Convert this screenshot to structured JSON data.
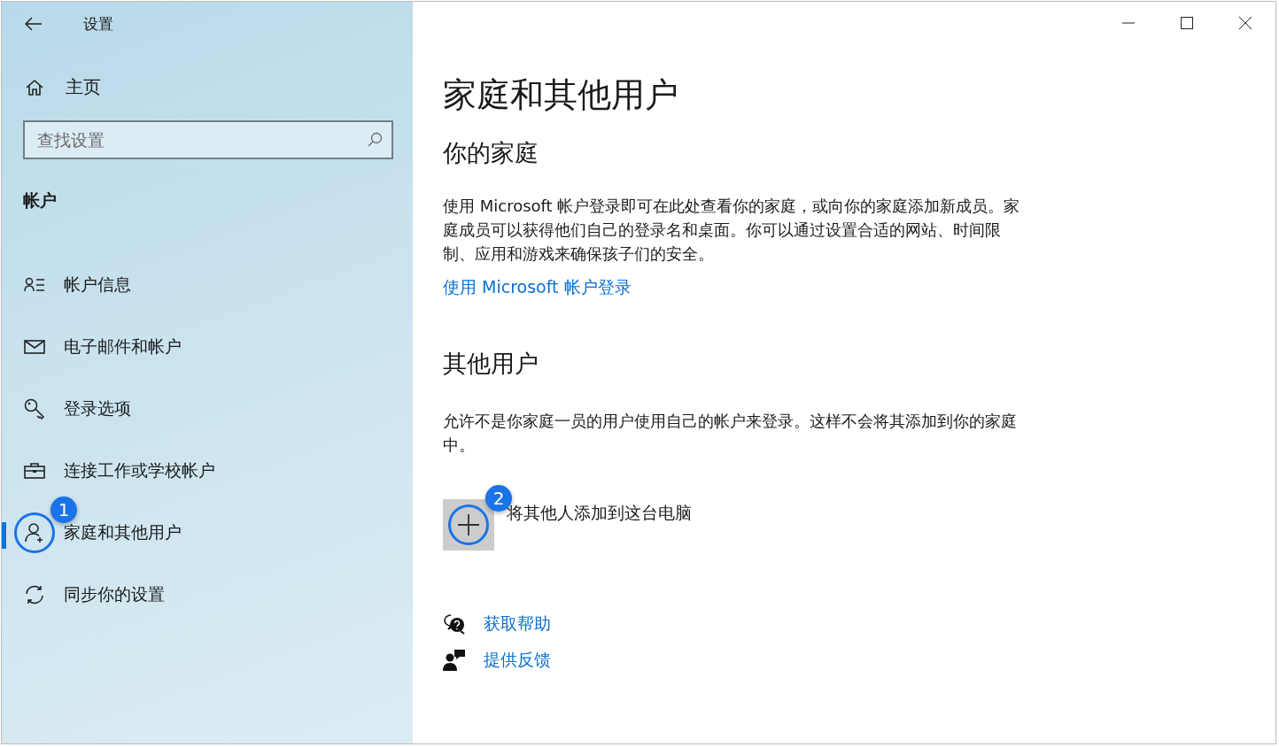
{
  "window": {
    "title": "设置"
  },
  "sidebar": {
    "home": "主页",
    "search": {
      "placeholder": "查找设置"
    },
    "section": "帐户",
    "items": [
      {
        "label": "帐户信息",
        "selected": false
      },
      {
        "label": "电子邮件和帐户",
        "selected": false
      },
      {
        "label": "登录选项",
        "selected": false
      },
      {
        "label": "连接工作或学校帐户",
        "selected": false
      },
      {
        "label": "家庭和其他用户",
        "selected": true,
        "callout": "1"
      },
      {
        "label": "同步你的设置",
        "selected": false
      }
    ]
  },
  "main": {
    "title": "家庭和其他用户",
    "family": {
      "heading": "你的家庭",
      "text": "使用 Microsoft 帐户登录即可在此处查看你的家庭，或向你的家庭添加新成员。家庭成员可以获得他们自己的登录名和桌面。你可以通过设置合适的网站、时间限制、应用和游戏来确保孩子们的安全。",
      "link": "使用 Microsoft 帐户登录"
    },
    "others": {
      "heading": "其他用户",
      "text": "允许不是你家庭一员的用户使用自己的帐户来登录。这样不会将其添加到你的家庭中。",
      "add": {
        "label": "将其他人添加到这台电脑",
        "callout": "2"
      }
    },
    "links": [
      "获取帮助",
      "提供反馈"
    ]
  }
}
